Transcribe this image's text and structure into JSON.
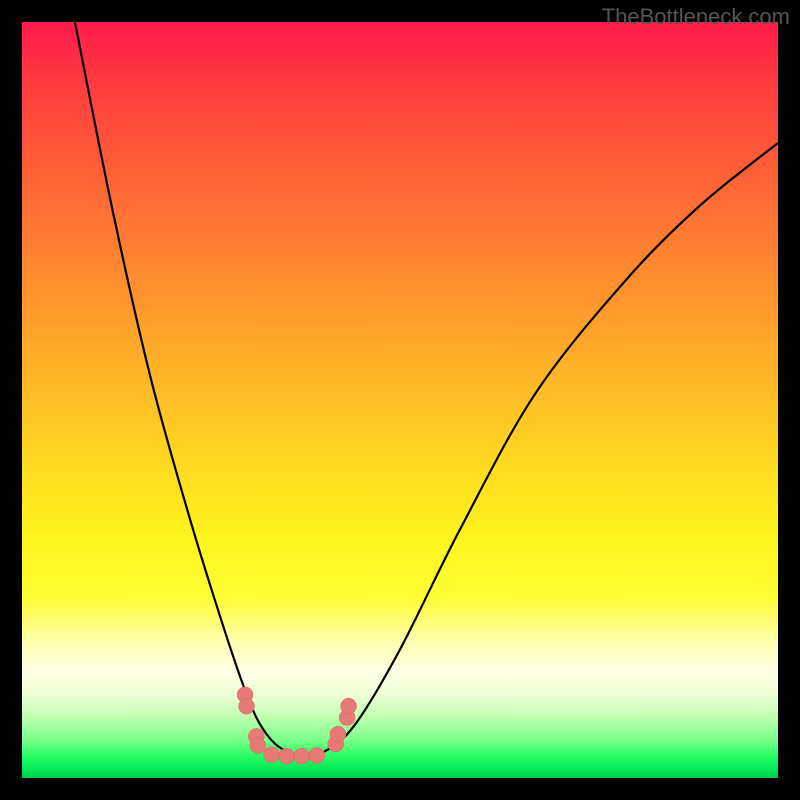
{
  "watermark": "TheBottleneck.com",
  "chart_data": {
    "type": "line",
    "title": "",
    "xlabel": "",
    "ylabel": "",
    "xlim": [
      0,
      100
    ],
    "ylim": [
      0,
      100
    ],
    "description": "Bottleneck curve with red-to-green vertical gradient background. Two black curved lines descend from top edges, meet at a minimum basin near x≈33-40, y≈3, then right curve rises toward upper right. Salmon-colored circular markers cluster at the basin.",
    "series": [
      {
        "name": "left-branch",
        "x": [
          7,
          12,
          17,
          22,
          26,
          29,
          31,
          33,
          35,
          37
        ],
        "y": [
          100,
          75,
          53,
          35,
          22,
          13,
          8,
          5,
          3.5,
          3
        ]
      },
      {
        "name": "right-branch",
        "x": [
          37,
          40,
          44,
          50,
          58,
          68,
          80,
          90,
          100
        ],
        "y": [
          3,
          3.5,
          7,
          17,
          33,
          51,
          66,
          76,
          84
        ]
      }
    ],
    "markers": {
      "name": "basin-points",
      "color": "#e77a74",
      "points": [
        {
          "x": 29.5,
          "y": 11
        },
        {
          "x": 29.7,
          "y": 9.5
        },
        {
          "x": 31,
          "y": 5.5
        },
        {
          "x": 31.2,
          "y": 4.3
        },
        {
          "x": 33,
          "y": 3.1
        },
        {
          "x": 35,
          "y": 2.9
        },
        {
          "x": 37,
          "y": 2.9
        },
        {
          "x": 39,
          "y": 3.0
        },
        {
          "x": 41.5,
          "y": 4.5
        },
        {
          "x": 41.8,
          "y": 5.8
        },
        {
          "x": 43,
          "y": 8
        },
        {
          "x": 43.2,
          "y": 9.5
        }
      ]
    }
  }
}
